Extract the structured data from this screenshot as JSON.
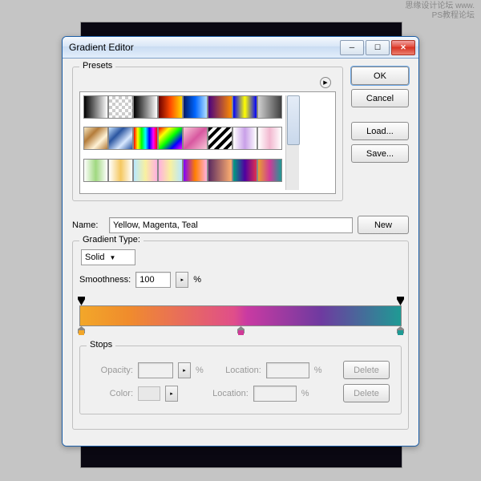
{
  "watermark": {
    "line1": "思缘设计论坛 www.",
    "line2": "PS教程论坛"
  },
  "dialog": {
    "title": "Gradient Editor",
    "buttons": {
      "ok": "OK",
      "cancel": "Cancel",
      "load": "Load...",
      "save": "Save...",
      "new": "New",
      "delete": "Delete"
    },
    "presets_label": "Presets",
    "name_label": "Name:",
    "name_value": "Yellow, Magenta, Teal",
    "grad_type_label": "Gradient Type:",
    "grad_type_value": "Solid",
    "smooth_label": "Smoothness:",
    "smooth_value": "100",
    "smooth_unit": "%",
    "stops_label": "Stops",
    "opacity_label": "Opacity:",
    "color_label": "Color:",
    "location_label": "Location:",
    "pct": "%"
  },
  "gradient": {
    "opacity_stops": [
      {
        "pos": 0
      },
      {
        "pos": 100
      }
    ],
    "color_stops": [
      {
        "pos": 0,
        "color": "#f2a72a"
      },
      {
        "pos": 50,
        "color": "#d03a98"
      },
      {
        "pos": 100,
        "color": "#1f9a94"
      }
    ]
  },
  "presets": [
    "linear-gradient(90deg,#000,#fff)",
    "repeating-conic-gradient(#ccc 0 25%,#fff 0 50%) 0 0/8px 8px",
    "linear-gradient(90deg,#000,#fff)",
    "linear-gradient(90deg,#6b0000,#ff4a00,#ffd800)",
    "linear-gradient(90deg,#001a66,#0066ff,#b3e0ff)",
    "linear-gradient(90deg,#4a0080,#ff8c00)",
    "linear-gradient(90deg,#0000ff,#ffff00,#0000ff)",
    "linear-gradient(90deg,#d0d0d0,#404040)",
    "linear-gradient(135deg,#f7e7c1,#b47c3a,#fff3d6,#b47c3a)",
    "linear-gradient(135deg,#c0dfff,#2a55a0,#d8e8ff,#2a55a0)",
    "linear-gradient(90deg,#ff0000,#ffff00,#00ff00,#00ffff,#0000ff,#ff00ff,#ff0000)",
    "linear-gradient(135deg,#ff0000,#ffff00,#00ff00,#0000ff,#ff00ff)",
    "linear-gradient(135deg,#f8c8d8,#d858a0,#f8c8d8)",
    "repeating-linear-gradient(135deg,#000 0 4px,#fff 4px 8px)",
    "linear-gradient(90deg,#fff,#c9a0e8,#fff)",
    "linear-gradient(90deg,#fff,#f2b8d0,#fff)",
    "linear-gradient(90deg,#fff,#a0d880,#fff)",
    "linear-gradient(90deg,#fff,#f5c860,#fff)",
    "linear-gradient(90deg,#b8e8ff,#f8f0a0,#ffb0e0)",
    "linear-gradient(90deg,#ffb0e0,#f8f0a0,#b8e8ff)",
    "linear-gradient(90deg,#8000ff,#ff8000,#ffb0e0)",
    "linear-gradient(90deg,#5a2a60,#ffb070)",
    "linear-gradient(90deg,#00a080,#5000a0,#e03050)",
    "linear-gradient(90deg,#e8a030,#d03a98,#1f9a94)"
  ]
}
